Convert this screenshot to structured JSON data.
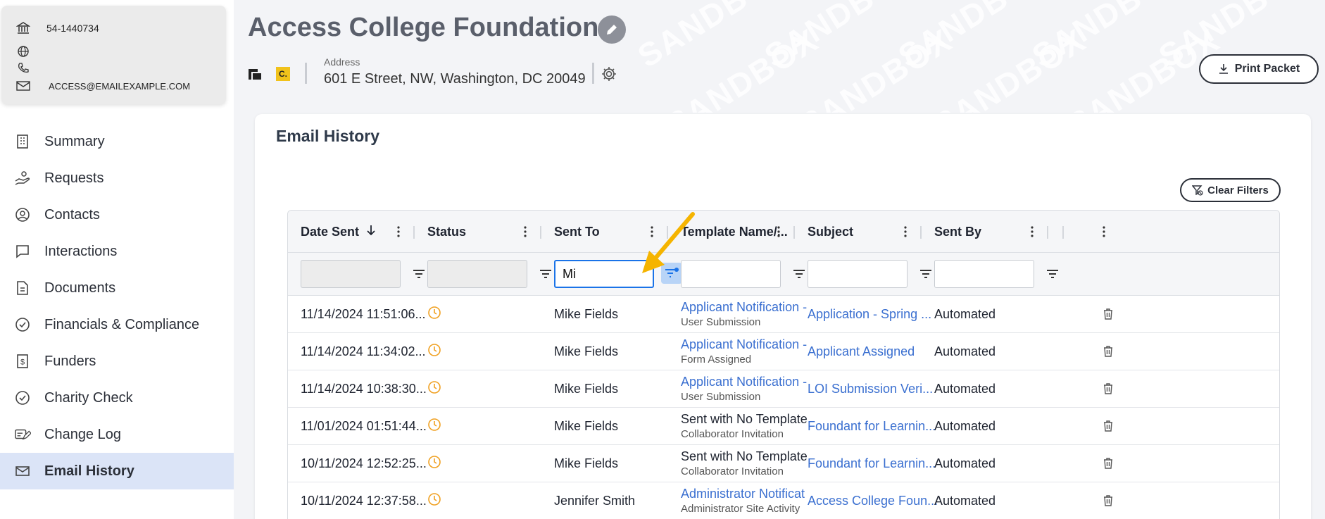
{
  "org": {
    "ein": "54-1440734",
    "email": "ACCESS@EMAILEXAMPLE.COM",
    "name": "Access College Foundation",
    "address_label": "Address",
    "address": "601 E Street, NW, Washington, DC 20049",
    "logo_c": "C."
  },
  "watermark": "SANDBOX",
  "nav": [
    {
      "label": "Summary",
      "icon": "building-icon"
    },
    {
      "label": "Requests",
      "icon": "hand-icon"
    },
    {
      "label": "Contacts",
      "icon": "person-circle-icon"
    },
    {
      "label": "Interactions",
      "icon": "chat-icon"
    },
    {
      "label": "Documents",
      "icon": "document-icon"
    },
    {
      "label": "Financials & Compliance",
      "icon": "check-circle-icon"
    },
    {
      "label": "Funders",
      "icon": "dollar-icon"
    },
    {
      "label": "Charity Check",
      "icon": "check-circle-icon"
    },
    {
      "label": "Change Log",
      "icon": "edit-log-icon"
    },
    {
      "label": "Email History",
      "icon": "mail-icon",
      "active": true
    }
  ],
  "header": {
    "print_label": "Print Packet"
  },
  "email_history": {
    "title": "Email History",
    "clear_filters_label": "Clear Filters",
    "columns": [
      "Date Sent",
      "Status",
      "Sent To",
      "Template Name/...",
      "Subject",
      "Sent By"
    ],
    "filters": {
      "sent_to_value": "Mi"
    },
    "rows": [
      {
        "date": "11/14/2024 11:51:06...",
        "sent_to": "Mike Fields",
        "template": "Applicant Notification -",
        "template_sub": "User Submission",
        "template_link": true,
        "subject": "Application - Spring ...",
        "sent_by": "Automated"
      },
      {
        "date": "11/14/2024 11:34:02...",
        "sent_to": "Mike Fields",
        "template": "Applicant Notification -",
        "template_sub": "Form Assigned",
        "template_link": true,
        "subject": "Applicant Assigned",
        "sent_by": "Automated"
      },
      {
        "date": "11/14/2024 10:38:30...",
        "sent_to": "Mike Fields",
        "template": "Applicant Notification -",
        "template_sub": "User Submission",
        "template_link": true,
        "subject": "LOI Submission Veri...",
        "sent_by": "Automated"
      },
      {
        "date": "11/01/2024 01:51:44...",
        "sent_to": "Mike Fields",
        "template": "Sent with No Template",
        "template_sub": "Collaborator Invitation",
        "template_link": false,
        "subject": "Foundant for Learnin...",
        "sent_by": "Automated"
      },
      {
        "date": "10/11/2024 12:52:25...",
        "sent_to": "Mike Fields",
        "template": "Sent with No Template",
        "template_sub": "Collaborator Invitation",
        "template_link": false,
        "subject": "Foundant for Learnin...",
        "sent_by": "Automated"
      },
      {
        "date": "10/11/2024 12:37:58...",
        "sent_to": "Jennifer Smith",
        "template": "Administrator Notificat",
        "template_sub": "Administrator Site Activity",
        "template_link": true,
        "subject": "Access College Foun...",
        "sent_by": "Automated"
      }
    ]
  },
  "colors": {
    "accent": "#3a6fd0",
    "status_pending": "#f0a020",
    "active_nav": "#dbe4f7",
    "arrow": "#f5b400"
  }
}
